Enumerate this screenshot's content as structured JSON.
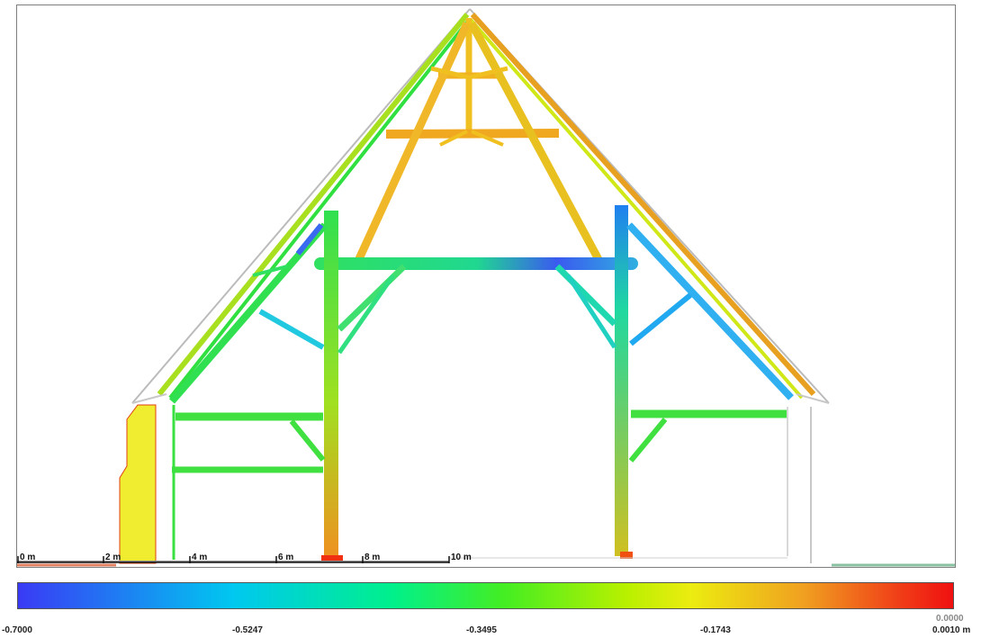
{
  "scale_bar": {
    "labels": [
      "0 m",
      "2 m",
      "4 m",
      "6 m",
      "8 m",
      "10 m"
    ]
  },
  "colorbar": {
    "ticks": [
      "-0.7000",
      "-0.5247",
      "-0.3495",
      "-0.1743"
    ],
    "max_top": "0.0000",
    "max_bottom": "0.0010 m"
  },
  "colors": {
    "blue": "#3a3af5",
    "cyan": "#00c8f0",
    "teal": "#22d8a0",
    "green": "#22e840",
    "lime": "#9cf000",
    "yellow": "#f0e820",
    "orange": "#f0a020",
    "red": "#f02010"
  }
}
